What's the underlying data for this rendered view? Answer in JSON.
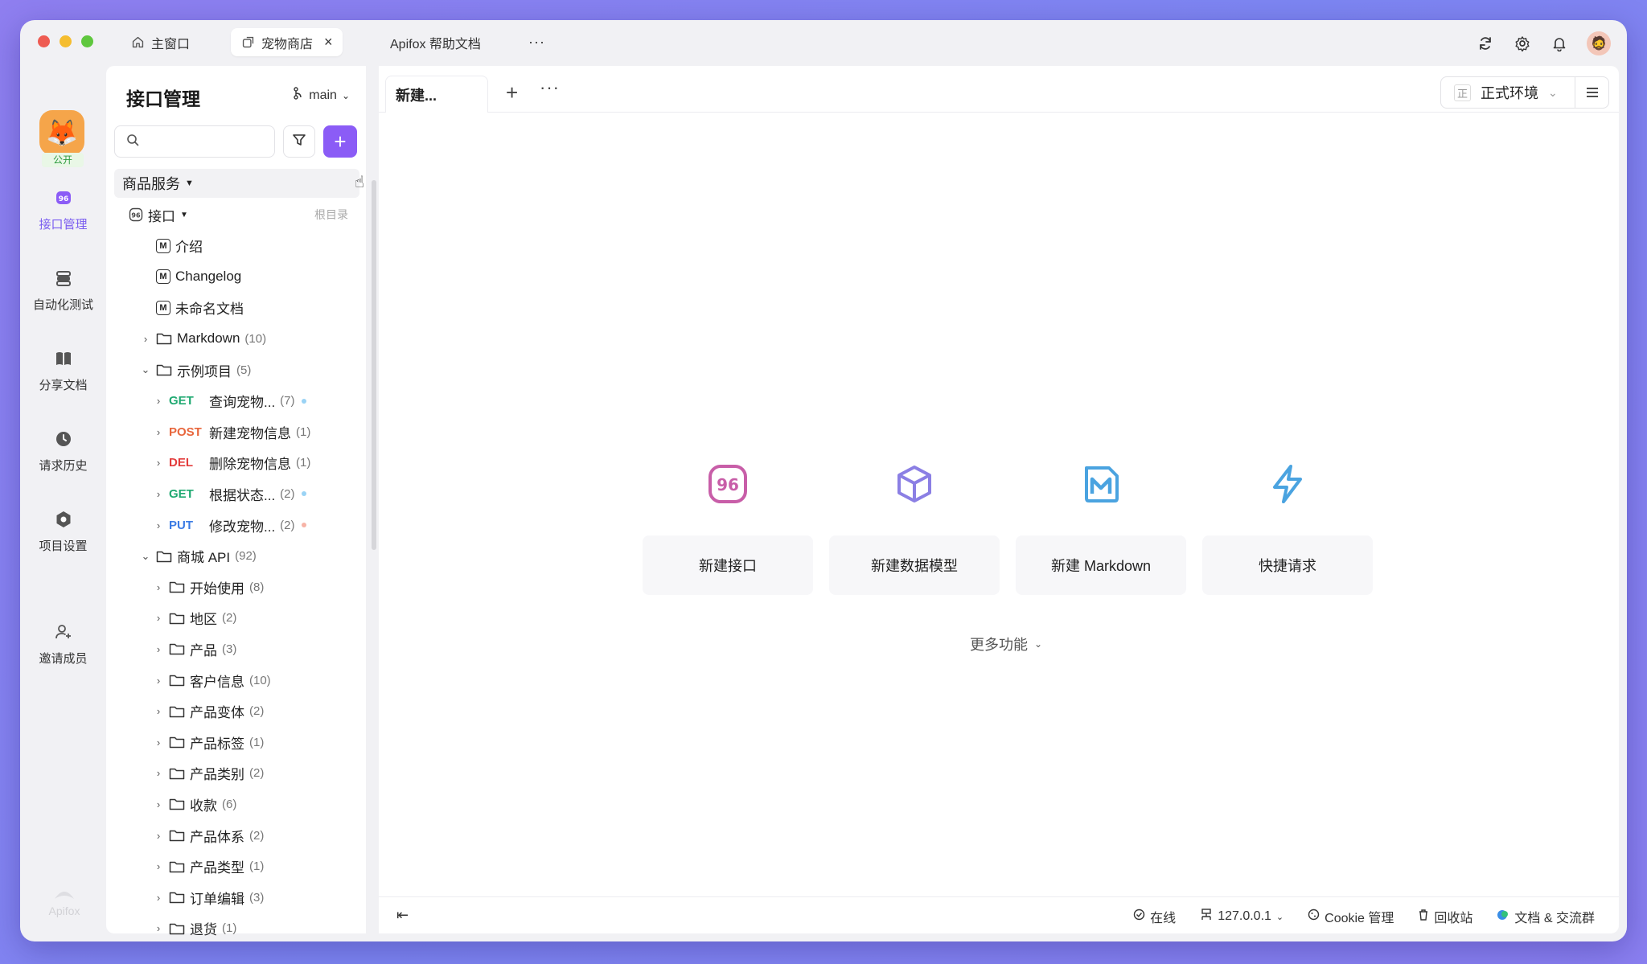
{
  "titlebar": {
    "tabs": [
      {
        "label": "主窗口",
        "icon": "home-icon"
      },
      {
        "label": "宠物商店",
        "icon": "external-window-icon"
      },
      {
        "label": "Apifox 帮助文档",
        "icon": ""
      }
    ],
    "more": "···"
  },
  "rail": {
    "badge": "公开",
    "items": [
      {
        "label": "接口管理",
        "icon": "api-icon"
      },
      {
        "label": "自动化测试",
        "icon": "stack-icon"
      },
      {
        "label": "分享文档",
        "icon": "book-icon"
      },
      {
        "label": "请求历史",
        "icon": "clock-icon"
      },
      {
        "label": "项目设置",
        "icon": "settings-icon"
      },
      {
        "label": "邀请成员",
        "icon": "add-user-icon"
      }
    ],
    "footer": "Apifox"
  },
  "sidebar": {
    "title": "接口管理",
    "branch": "main",
    "search_placeholder": "",
    "service": "商品服务",
    "root_hint": "根目录",
    "tree": [
      {
        "type": "group",
        "label": "接口",
        "indent": 0
      },
      {
        "type": "md",
        "label": "介绍"
      },
      {
        "type": "md",
        "label": "Changelog"
      },
      {
        "type": "md",
        "label": "未命名文档"
      },
      {
        "type": "folder",
        "label": "Markdown",
        "count": "(10)",
        "open": false
      },
      {
        "type": "folder",
        "label": "示例项目",
        "count": "(5)",
        "open": true
      },
      {
        "type": "api",
        "method": "GET",
        "label": "查询宠物...",
        "count": "(7)",
        "dot": "#9ad3f5"
      },
      {
        "type": "api",
        "method": "POST",
        "label": "新建宠物信息",
        "count": "(1)",
        "dot": ""
      },
      {
        "type": "api",
        "method": "DEL",
        "label": "删除宠物信息",
        "count": "(1)",
        "dot": ""
      },
      {
        "type": "api",
        "method": "GET",
        "label": "根据状态...",
        "count": "(2)",
        "dot": "#9ad3f5"
      },
      {
        "type": "api",
        "method": "PUT",
        "label": "修改宠物...",
        "count": "(2)",
        "dot": "#f7b3a6"
      },
      {
        "type": "folder",
        "label": "商城 API",
        "count": "(92)",
        "open": true
      },
      {
        "type": "subfolder",
        "label": "开始使用",
        "count": "(8)"
      },
      {
        "type": "subfolder",
        "label": "地区",
        "count": "(2)"
      },
      {
        "type": "subfolder",
        "label": "产品",
        "count": "(3)"
      },
      {
        "type": "subfolder",
        "label": "客户信息",
        "count": "(10)"
      },
      {
        "type": "subfolder",
        "label": "产品变体",
        "count": "(2)"
      },
      {
        "type": "subfolder",
        "label": "产品标签",
        "count": "(1)"
      },
      {
        "type": "subfolder",
        "label": "产品类别",
        "count": "(2)"
      },
      {
        "type": "subfolder",
        "label": "收款",
        "count": "(6)"
      },
      {
        "type": "subfolder",
        "label": "产品体系",
        "count": "(2)"
      },
      {
        "type": "subfolder",
        "label": "产品类型",
        "count": "(1)"
      },
      {
        "type": "subfolder",
        "label": "订单编辑",
        "count": "(3)"
      },
      {
        "type": "subfolder",
        "label": "退货",
        "count": "(1)"
      }
    ]
  },
  "main": {
    "tab": "新建...",
    "env": {
      "mark": "正",
      "label": "正式环境"
    },
    "actions": [
      {
        "label": "新建接口",
        "icon": "api-icon",
        "color": "#c85ea8"
      },
      {
        "label": "新建数据模型",
        "icon": "cube-icon",
        "color": "#8b7fe4"
      },
      {
        "label": "新建 Markdown",
        "icon": "markdown-icon",
        "color": "#4aa3e0"
      },
      {
        "label": "快捷请求",
        "icon": "lightning-icon",
        "color": "#4aa3e0"
      }
    ],
    "more_label": "更多功能"
  },
  "status": {
    "online": "在线",
    "host": "127.0.0.1",
    "cookie": "Cookie 管理",
    "trash": "回收站",
    "docs": "文档 & 交流群"
  },
  "colors": {
    "accent": "#8b5cf6",
    "get": "#1fa971",
    "post": "#e8663c",
    "del": "#e33d3d",
    "put": "#3b7be4"
  }
}
